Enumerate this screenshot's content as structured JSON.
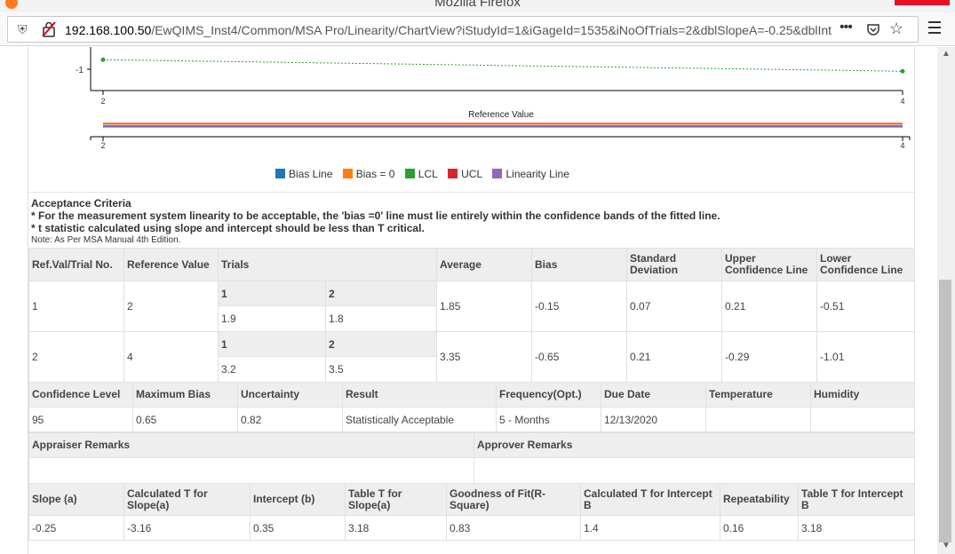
{
  "window": {
    "title": "Mozilla Firefox"
  },
  "address_bar": {
    "host": "192.168.100.50",
    "path": "/EwQIMS_Inst4/Common/MSA Pro/Linearity/ChartView?iStudyId=1&iGageId=1535&iNoOfTrials=2&dblSlopeA=-0.25&dblInt",
    "overflow_label": "•••"
  },
  "colors": {
    "bias_line": "#1f77b4",
    "bias_zero": "#ff7f0e",
    "lcl": "#2ca02c",
    "ucl": "#d62728",
    "linearity_line": "#9467bd"
  },
  "chart_data": [
    {
      "type": "line",
      "xlabel": "",
      "ytick_labels": [
        "-1"
      ],
      "xtick_labels": [
        "2",
        "4"
      ],
      "series": [
        {
          "name": "LCL",
          "x": [
            2,
            4
          ],
          "y": [
            -0.51,
            -1.01
          ]
        }
      ]
    },
    {
      "type": "line",
      "xlabel": "Reference Value",
      "xtick_labels": [
        "2",
        "4"
      ],
      "series": [
        {
          "name": "Bias Line",
          "x": [
            2,
            4
          ],
          "y": [
            0,
            0
          ]
        },
        {
          "name": "Bias = 0",
          "x": [
            2,
            4
          ],
          "y": [
            0,
            0
          ]
        },
        {
          "name": "UCL",
          "x": [
            2,
            4
          ],
          "y": [
            0,
            0
          ]
        },
        {
          "name": "Linearity Line",
          "x": [
            2,
            4
          ],
          "y": [
            0,
            0
          ]
        }
      ]
    }
  ],
  "legend": [
    "Bias Line",
    "Bias = 0",
    "LCL",
    "UCL",
    "Linearity Line"
  ],
  "criteria": {
    "title": "Acceptance Criteria",
    "line1": "* For the measurement system linearity to be acceptable, the 'bias =0' line must lie entirely within the confidence bands of the fitted line.",
    "line2": "* t statistic calculated using slope and intercept should be less than T critical.",
    "note": "Note: As Per MSA Manual 4th Edition."
  },
  "results_table": {
    "headers": [
      "Ref.Val/Trial No.",
      "Reference Value",
      "Trials",
      "Average",
      "Bias",
      "Standard Deviation",
      "Upper Confidence Line",
      "Lower Confidence Line"
    ],
    "rows": [
      {
        "ref": "1",
        "refval": "2",
        "trial_nums": [
          "1",
          "2"
        ],
        "trials": [
          "1.9",
          "1.8"
        ],
        "avg": "1.85",
        "bias": "-0.15",
        "sd": "0.07",
        "ucl": "0.21",
        "lcl": "-0.51"
      },
      {
        "ref": "2",
        "refval": "4",
        "trial_nums": [
          "1",
          "2"
        ],
        "trials": [
          "3.2",
          "3.5"
        ],
        "avg": "3.35",
        "bias": "-0.65",
        "sd": "0.21",
        "ucl": "-0.29",
        "lcl": "-1.01"
      }
    ]
  },
  "summary_table": {
    "headers": [
      "Confidence Level",
      "Maximum Bias",
      "Uncertainty",
      "Result",
      "Frequency(Opt.)",
      "Due Date",
      "Temperature",
      "Humidity"
    ],
    "values": [
      "95",
      "0.65",
      "0.82",
      "Statistically Acceptable",
      "5 - Months",
      "12/13/2020",
      "",
      ""
    ]
  },
  "remarks_table": {
    "headers": [
      "Appraiser Remarks",
      "Approver Remarks"
    ],
    "values": [
      "",
      ""
    ]
  },
  "stats_table": {
    "headers": [
      "Slope (a)",
      "Calculated T for Slope(a)",
      "Intercept (b)",
      "Table T for Slope(a)",
      "Goodness of Fit(R-Square)",
      "Calculated T for Intercept B",
      "Repeatability",
      "Table T for Intercept B"
    ],
    "values": [
      "-0.25",
      "-3.16",
      "0.35",
      "3.18",
      "0.83",
      "1.4",
      "0.16",
      "3.18"
    ]
  }
}
